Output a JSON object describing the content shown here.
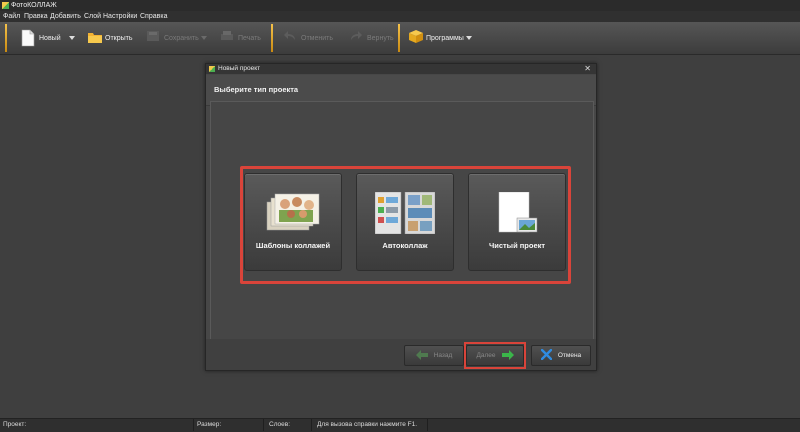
{
  "app": {
    "title": "ФотоКОЛЛАЖ"
  },
  "menu": [
    "Файл",
    "Правка",
    "Добавить",
    "Слой",
    "Настройки",
    "Справка"
  ],
  "toolbar": {
    "new": "Новый",
    "open": "Открыть",
    "save": "Сохранить",
    "print": "Печать",
    "undo": "Отменить",
    "redo": "Вернуть",
    "programs": "Программы"
  },
  "dialog": {
    "title": "Новый проект",
    "heading": "Выберите тип проекта",
    "close": "✕",
    "cards": [
      {
        "label": "Шаблоны коллажей",
        "icon": "collage-templates-icon"
      },
      {
        "label": "Автоколлаж",
        "icon": "auto-collage-icon"
      },
      {
        "label": "Чистый проект",
        "icon": "blank-project-icon"
      }
    ],
    "buttons": {
      "back": "Назад",
      "next": "Далее",
      "cancel": "Отмена"
    }
  },
  "status": {
    "project": "Проект:",
    "size": "Размер:",
    "layers": "Слоев:",
    "help": "Для вызова справки нажмите F1."
  },
  "colors": {
    "accent": "#d9443a",
    "toolbar_separator": "#f5c24a",
    "arrow": "#3bb54a",
    "cancel": "#2f8be0"
  }
}
